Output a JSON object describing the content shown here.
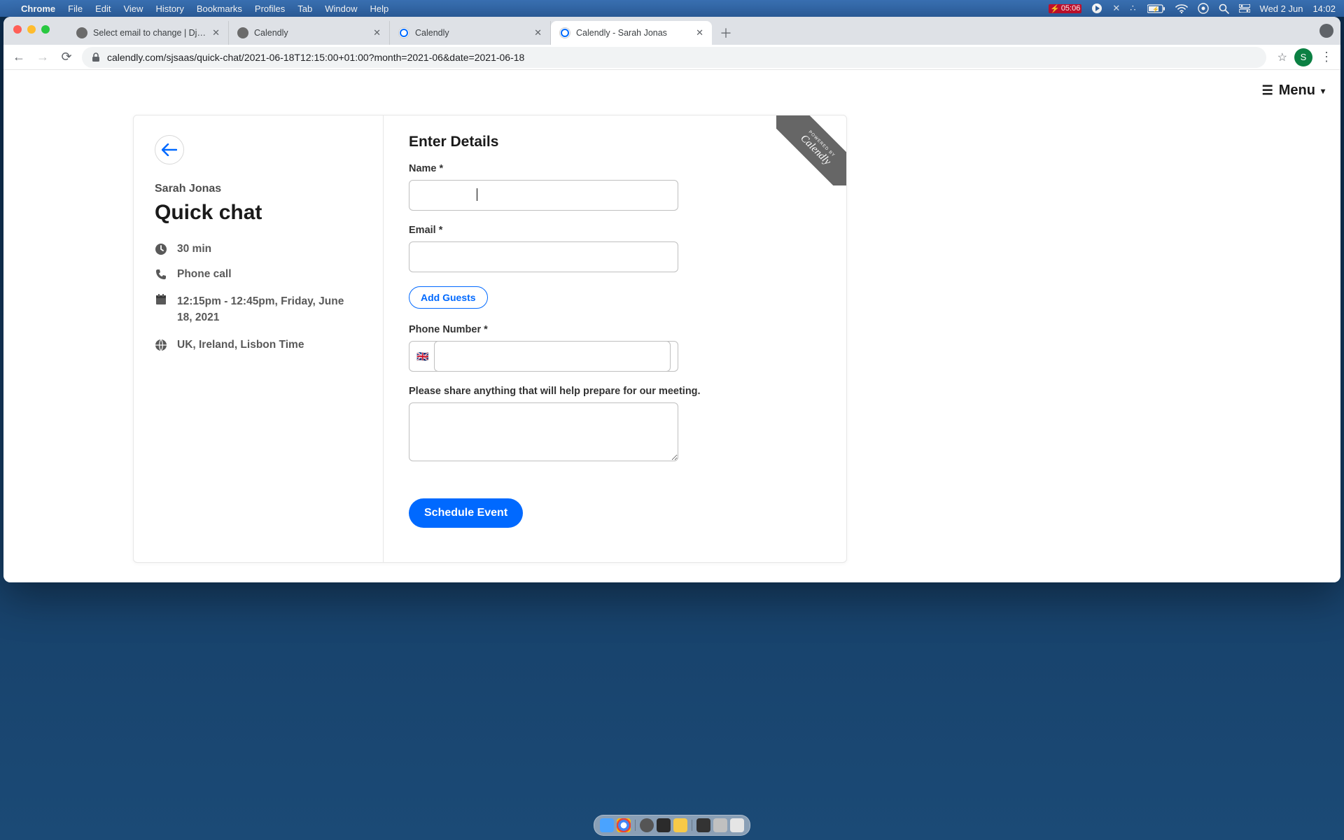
{
  "menubar": {
    "apple": "",
    "app": "Chrome",
    "items": [
      "File",
      "Edit",
      "View",
      "History",
      "Bookmarks",
      "Profiles",
      "Tab",
      "Window",
      "Help"
    ],
    "battery_label": "05:06",
    "date": "Wed 2 Jun",
    "time": "14:02"
  },
  "tabs": [
    {
      "title": "Select email to change | Django",
      "favicon": "gear"
    },
    {
      "title": "Calendly",
      "favicon": "gear"
    },
    {
      "title": "Calendly",
      "favicon": "calendly"
    },
    {
      "title": "Calendly - Sarah Jonas",
      "favicon": "calendly",
      "active": true
    }
  ],
  "omnibox": {
    "url": "calendly.com/sjsaas/quick-chat/2021-06-18T12:15:00+01:00?month=2021-06&date=2021-06-18"
  },
  "avatar_initial": "S",
  "page_menu": "Menu",
  "booking": {
    "host": "Sarah Jonas",
    "event": "Quick chat",
    "duration": "30 min",
    "location": "Phone call",
    "datetime": "12:15pm - 12:45pm, Friday, June 18, 2021",
    "timezone": "UK, Ireland, Lisbon Time"
  },
  "form": {
    "heading": "Enter Details",
    "name_label": "Name *",
    "name_value": "",
    "email_label": "Email *",
    "email_value": "",
    "add_guests": "Add Guests",
    "phone_label": "Phone Number *",
    "phone_flag": "🇬🇧",
    "phone_value": "",
    "notes_label": "Please share anything that will help prepare for our meeting.",
    "notes_value": "",
    "submit": "Schedule Event"
  },
  "ribbon": {
    "powered": "POWERED BY",
    "brand": "Calendly"
  }
}
